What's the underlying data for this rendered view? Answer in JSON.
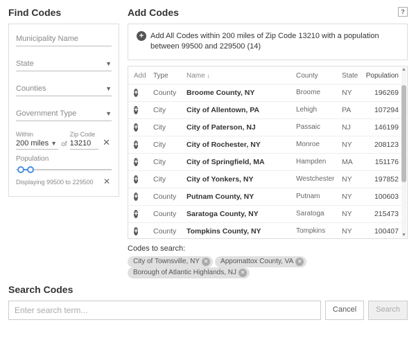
{
  "find": {
    "title": "Find Codes",
    "municipality_ph": "Municipality Name",
    "state_ph": "State",
    "counties_ph": "Counties",
    "govtype_ph": "Government Type",
    "within_label": "Within",
    "within_value": "200 miles",
    "of_label": "of",
    "zip_label": "Zip Code",
    "zip_value": "13210",
    "population_label": "Population",
    "displaying": "Displaying 99500 to 229500"
  },
  "add": {
    "title": "Add Codes",
    "help": "?",
    "add_all_text": "Add All Codes within 200 miles of Zip Code 13210 with a population between 99500 and 229500 (14)",
    "headers": {
      "add": "Add",
      "type": "Type",
      "name": "Name",
      "county": "County",
      "state": "State",
      "pop": "Population"
    },
    "rows": [
      {
        "type": "County",
        "name": "Broome County, NY",
        "county": "Broome",
        "state": "NY",
        "pop": "196269"
      },
      {
        "type": "City",
        "name": "City of Allentown, PA",
        "county": "Lehigh",
        "state": "PA",
        "pop": "107294"
      },
      {
        "type": "City",
        "name": "City of Paterson, NJ",
        "county": "Passaic",
        "state": "NJ",
        "pop": "146199"
      },
      {
        "type": "City",
        "name": "City of Rochester, NY",
        "county": "Monroe",
        "state": "NY",
        "pop": "208123"
      },
      {
        "type": "City",
        "name": "City of Springfield, MA",
        "county": "Hampden",
        "state": "MA",
        "pop": "151176"
      },
      {
        "type": "City",
        "name": "City of Yonkers, NY",
        "county": "Westchester",
        "state": "NY",
        "pop": "197852"
      },
      {
        "type": "County",
        "name": "Putnam County, NY",
        "county": "Putnam",
        "state": "NY",
        "pop": "100603"
      },
      {
        "type": "County",
        "name": "Saratoga County, NY",
        "county": "Saratoga",
        "state": "NY",
        "pop": "215473"
      },
      {
        "type": "County",
        "name": "Tompkins County, NY",
        "county": "Tompkins",
        "state": "NY",
        "pop": "100407"
      }
    ]
  },
  "codes": {
    "label": "Codes to search:",
    "chips": [
      "City of Townsville, NY",
      "Appomattox County, VA",
      "Borough of Atlantic Highlands, NJ"
    ]
  },
  "search": {
    "title": "Search Codes",
    "placeholder": "Enter search term...",
    "cancel": "Cancel",
    "submit": "Search"
  }
}
